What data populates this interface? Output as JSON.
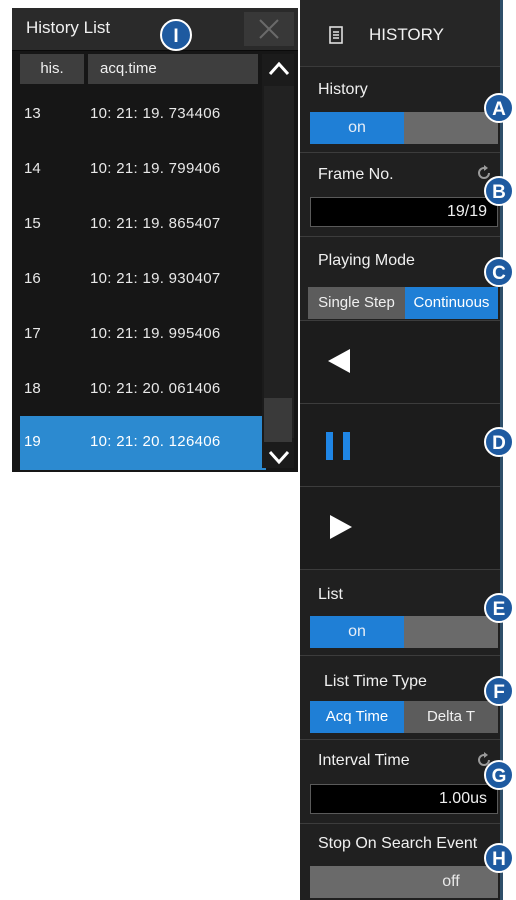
{
  "history_list": {
    "title": "History List",
    "columns": [
      "his.",
      "acq.time"
    ],
    "rows": [
      {
        "his": "13",
        "time": "10: 21: 19. 734406"
      },
      {
        "his": "14",
        "time": "10: 21: 19. 799406"
      },
      {
        "his": "15",
        "time": "10: 21: 19. 865407"
      },
      {
        "his": "16",
        "time": "10: 21: 19. 930407"
      },
      {
        "his": "17",
        "time": "10: 21: 19. 995406"
      },
      {
        "his": "18",
        "time": "10: 21: 20. 061406"
      },
      {
        "his": "19",
        "time": "10: 21: 20. 126406"
      }
    ],
    "selected_his": "19"
  },
  "menu": {
    "title": "HISTORY",
    "history": {
      "label": "History",
      "on": "on"
    },
    "frame_no": {
      "label": "Frame No.",
      "value": "19/19"
    },
    "playing_mode": {
      "label": "Playing Mode",
      "options": [
        "Single Step",
        "Continuous"
      ],
      "selected": "Continuous"
    },
    "list": {
      "label": "List",
      "on": "on"
    },
    "list_time_type": {
      "label": "List Time Type",
      "options": [
        "Acq Time",
        "Delta T"
      ],
      "selected": "Acq Time"
    },
    "interval_time": {
      "label": "Interval Time",
      "value": "1.00us"
    },
    "stop_on_search": {
      "label": "Stop On Search Event",
      "off": "off"
    }
  },
  "callouts": {
    "a": "A",
    "b": "B",
    "c": "C",
    "d": "D",
    "e": "E",
    "f": "F",
    "g": "G",
    "h": "H",
    "i": "I"
  },
  "colors": {
    "accent_blue": "#1f7fd6",
    "selected_row": "#2c8ad0",
    "badge": "#1e5aa0"
  }
}
